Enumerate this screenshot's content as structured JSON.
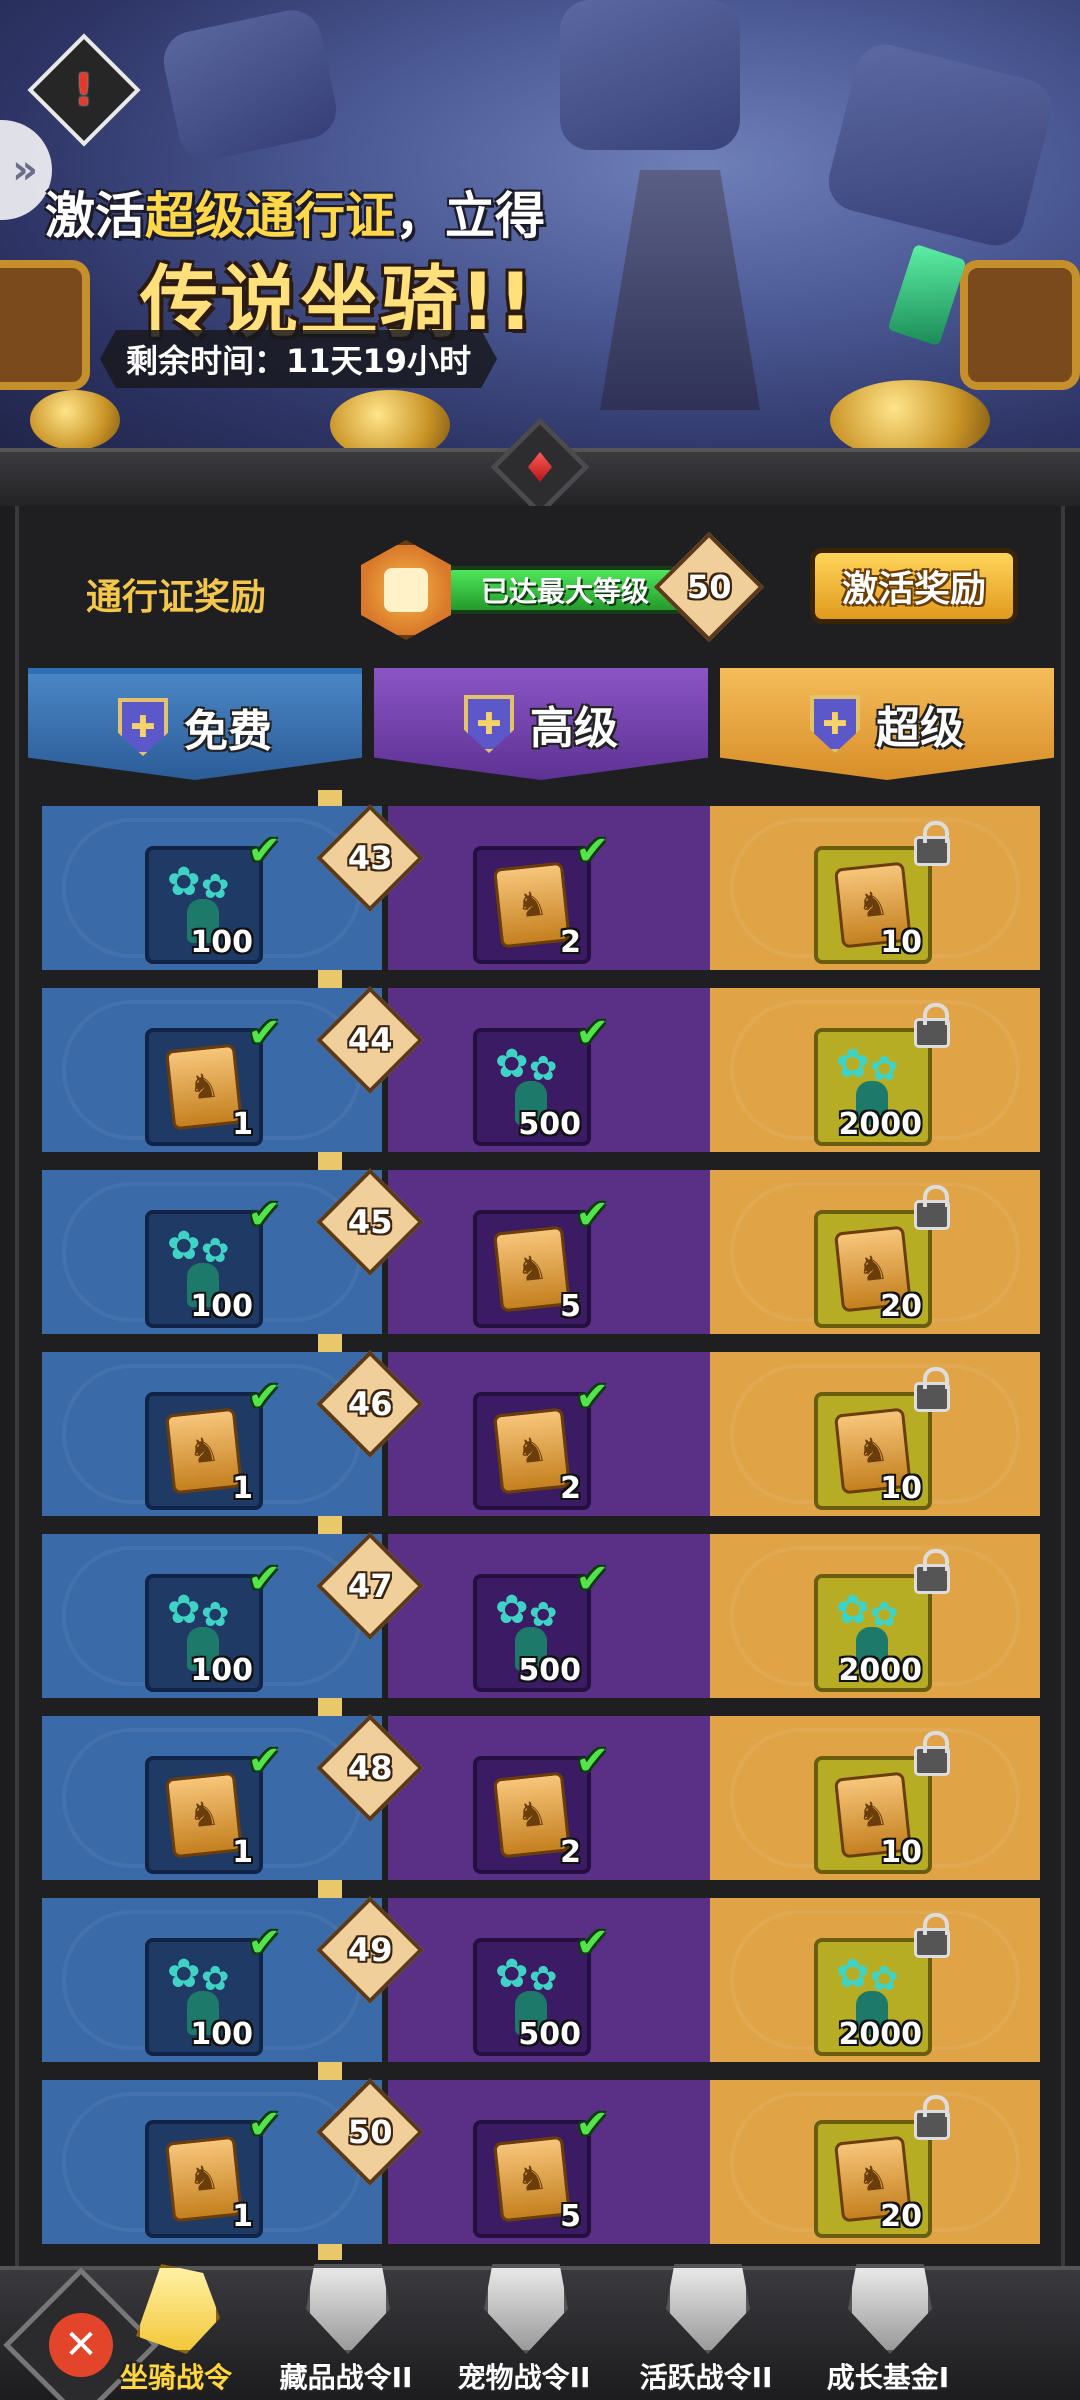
{
  "promo": {
    "line1_pre": "激活",
    "line1_highlight": "超级通行证",
    "line1_post": "，立得",
    "line2": "传说坐骑!!",
    "time_remaining": "剩余时间：11天19小时"
  },
  "header": {
    "pass_rewards_label": "通行证奖励",
    "level_status": "已达最大等级",
    "level": "50",
    "activate_button": "激活奖励"
  },
  "tiers": {
    "free": "免费",
    "premium": "高级",
    "super": "超级"
  },
  "rows": [
    {
      "level": "43",
      "free": {
        "icon": "plant-icon",
        "qty": "100",
        "claimed": true
      },
      "premium": {
        "icon": "scroll-icon",
        "qty": "2",
        "claimed": true
      },
      "super": {
        "icon": "scroll-icon",
        "qty": "10",
        "locked": true
      }
    },
    {
      "level": "44",
      "free": {
        "icon": "scroll-icon",
        "qty": "1",
        "claimed": true
      },
      "premium": {
        "icon": "plant-icon",
        "qty": "500",
        "claimed": true
      },
      "super": {
        "icon": "plant-icon",
        "qty": "2000",
        "locked": true
      }
    },
    {
      "level": "45",
      "free": {
        "icon": "plant-icon",
        "qty": "100",
        "claimed": true
      },
      "premium": {
        "icon": "scroll-icon",
        "qty": "5",
        "claimed": true
      },
      "super": {
        "icon": "scroll-icon",
        "qty": "20",
        "locked": true
      }
    },
    {
      "level": "46",
      "free": {
        "icon": "scroll-icon",
        "qty": "1",
        "claimed": true
      },
      "premium": {
        "icon": "scroll-icon",
        "qty": "2",
        "claimed": true
      },
      "super": {
        "icon": "scroll-icon",
        "qty": "10",
        "locked": true
      }
    },
    {
      "level": "47",
      "free": {
        "icon": "plant-icon",
        "qty": "100",
        "claimed": true
      },
      "premium": {
        "icon": "plant-icon",
        "qty": "500",
        "claimed": true
      },
      "super": {
        "icon": "plant-icon",
        "qty": "2000",
        "locked": true
      }
    },
    {
      "level": "48",
      "free": {
        "icon": "scroll-icon",
        "qty": "1",
        "claimed": true
      },
      "premium": {
        "icon": "scroll-icon",
        "qty": "2",
        "claimed": true
      },
      "super": {
        "icon": "scroll-icon",
        "qty": "10",
        "locked": true
      }
    },
    {
      "level": "49",
      "free": {
        "icon": "plant-icon",
        "qty": "100",
        "claimed": true
      },
      "premium": {
        "icon": "plant-icon",
        "qty": "500",
        "claimed": true
      },
      "super": {
        "icon": "plant-icon",
        "qty": "2000",
        "locked": true
      }
    },
    {
      "level": "50",
      "free": {
        "icon": "scroll-icon",
        "qty": "1",
        "claimed": true
      },
      "premium": {
        "icon": "scroll-icon",
        "qty": "5",
        "claimed": true
      },
      "super": {
        "icon": "scroll-icon",
        "qty": "20",
        "locked": true
      }
    }
  ],
  "bottom_nav": {
    "tabs": [
      {
        "label": "坐骑战令",
        "icon": "horse-icon",
        "active": true
      },
      {
        "label": "藏品战令II",
        "icon": "helmet-emblem-icon",
        "active": false
      },
      {
        "label": "宠物战令II",
        "icon": "shield-emblem-icon",
        "active": false
      },
      {
        "label": "活跃战令II",
        "icon": "star-emblem-icon",
        "active": false
      },
      {
        "label": "成长基金I",
        "icon": "wing-emblem-icon",
        "active": false
      }
    ]
  },
  "colors": {
    "free": "#3a6aa8",
    "premium": "#5a2f86",
    "super": "#e0a447",
    "claimed_check": "#53e34a",
    "accent_gold": "#f4c64a"
  }
}
